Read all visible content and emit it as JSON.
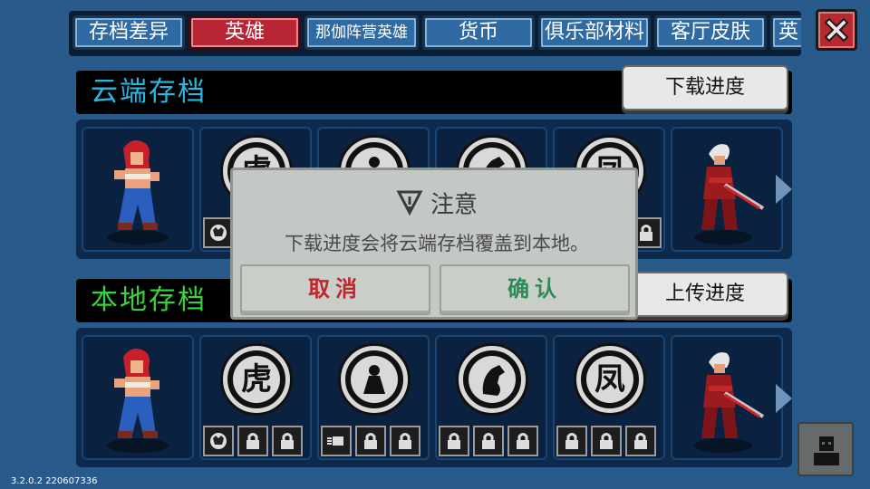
{
  "tabs": [
    {
      "label": "存档差异",
      "active": false
    },
    {
      "label": "英雄",
      "active": true
    },
    {
      "label": "那伽阵营英雄",
      "active": false
    },
    {
      "label": "货币",
      "active": false
    },
    {
      "label": "俱乐部材料",
      "active": false
    },
    {
      "label": "客厅皮肤",
      "active": false
    },
    {
      "label": "英",
      "active": false
    }
  ],
  "cloud": {
    "title": "云端存档",
    "action_label": "下载进度"
  },
  "local": {
    "title": "本地存档",
    "action_label": "上传进度"
  },
  "emblems": [
    {
      "glyph": "虎",
      "icon": "tiger-emblem"
    },
    {
      "glyph": "",
      "icon": "monk-emblem"
    },
    {
      "glyph": "",
      "icon": "horse-emblem"
    },
    {
      "glyph": "凤",
      "icon": "phoenix-emblem"
    }
  ],
  "dialog": {
    "title": "注意",
    "message": "下载进度会将云端存档覆盖到本地。",
    "cancel_label": "取消",
    "confirm_label": "确认"
  },
  "version": "3.2.0.2 220607336",
  "colors": {
    "background": "#285b8c",
    "active_tab": "#b82636",
    "cloud_title": "#27b9e4",
    "local_title": "#38d33b",
    "cancel_text": "#c0262b",
    "confirm_text": "#2f8a5a"
  }
}
